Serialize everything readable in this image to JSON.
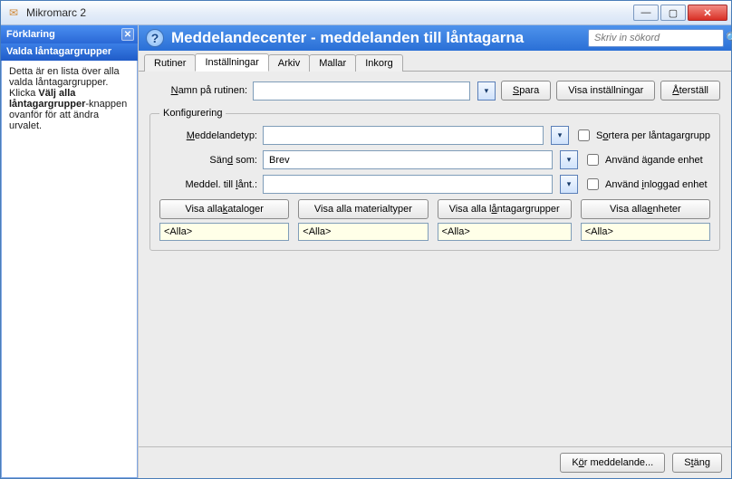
{
  "window": {
    "title": "Mikromarc 2"
  },
  "sidebar": {
    "panel_title": "Förklaring",
    "subtitle": "Valda låntagargrupper",
    "body_before": "Detta är en lista över alla valda låntagargrupper. Klicka ",
    "body_bold": "Välj alla låntagargrupper",
    "body_after": "-knappen ovanför för att ändra urvalet."
  },
  "header": {
    "title": "Meddelandecenter - meddelanden till låntagarna",
    "search_placeholder": "Skriv in sökord"
  },
  "tabs": [
    {
      "label": "Rutiner",
      "active": false
    },
    {
      "label": "Inställningar",
      "active": true
    },
    {
      "label": "Arkiv",
      "active": false
    },
    {
      "label": "Mallar",
      "active": false
    },
    {
      "label": "Inkorg",
      "active": false
    }
  ],
  "form": {
    "name_label_pre": "N",
    "name_label_post": "amn på rutinen:",
    "name_value": "",
    "spara_pre": "S",
    "spara_post": "para",
    "visa_inst": "Visa inställningar",
    "aterstall_pre": "Å",
    "aterstall_post": "terställ"
  },
  "konf": {
    "legend": "Konfigurering",
    "medd_label_pre": "M",
    "medd_label_post": "eddelandetyp:",
    "medd_value": "",
    "sand_label_pre": "Sän",
    "sand_label_u": "d",
    "sand_label_post": " som:",
    "sand_value": "Brev",
    "till_label_pre": "Meddel. till ",
    "till_label_u": "l",
    "till_label_post": "ånt.:",
    "till_value": "",
    "cb_sort_pre": "S",
    "cb_sort_u": "o",
    "cb_sort_post": "rtera per låntagargrupp",
    "cb_agande": "Använd ägande enhet",
    "cb_inlogg_pre": "Använd ",
    "cb_inlogg_u": "i",
    "cb_inlogg_post": "nloggad enhet"
  },
  "cols": {
    "kataloger_btn": "Visa alla kataloger",
    "kataloger_u": "k",
    "material_btn": "Visa alla materialtyper",
    "lant_btn_pre": "Visa alla l",
    "lant_btn_u": "å",
    "lant_btn_post": "ntagargrupper",
    "enheter_btn_pre": "Visa alla ",
    "enheter_btn_u": "e",
    "enheter_btn_post": "nheter",
    "all_text": "<Alla>"
  },
  "footer": {
    "kor_pre": "K",
    "kor_u": "ö",
    "kor_post": "r meddelande...",
    "stang_pre": "S",
    "stang_u": "t",
    "stang_mid": "än",
    "stang_post": "g"
  }
}
